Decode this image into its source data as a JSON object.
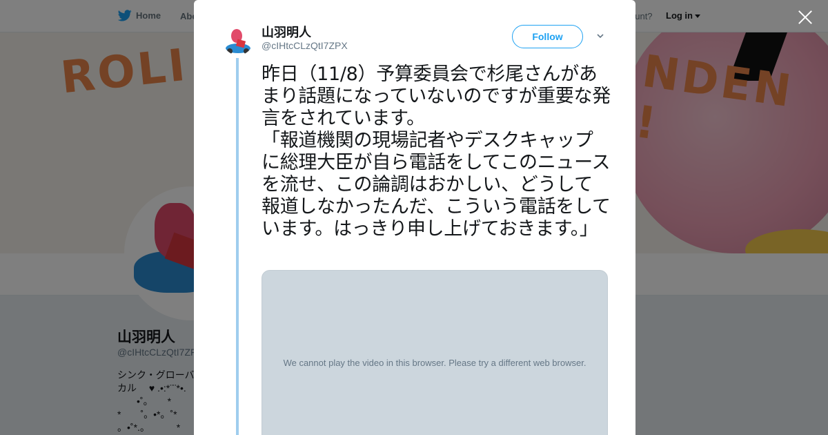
{
  "nav": {
    "home_label": "Home",
    "about_label": "Abo",
    "account_prompt": "ccount?",
    "login_label": "Log in"
  },
  "banner": {
    "text_left": "ROLI",
    "text_right": "NDEN !"
  },
  "profile": {
    "name": "山羽明人",
    "handle": "@cIHtcCLzQtI7ZF",
    "bio": "シンク・グローバ\nカル　 ♥ .•:*¨¨*•.\n　　•˚。　　*\n*　　˚。•*。˚*\n。•˚*.。　　　 *"
  },
  "tweet": {
    "author_name": "山羽明人",
    "author_handle": "@cIHtcCLzQtI7ZPX",
    "follow_label": "Follow",
    "text": "昨日（11/8）予算委員会で杉尾さんがあまり話題になっていないのですが重要な発言をされています。\n「報道機関の現場記者やデスクキャップに総理大臣が自ら電話をしてこのニュースを流せ、この論調はおかしい、どうして報道しなかったんだ、こういう電話をしています。はっきり申し上げておきます。」",
    "video_message": "We cannot play the video in this browser. Please try a different web browser."
  },
  "colors": {
    "accent": "#1da1f2",
    "thread_line": "#9fcdee",
    "video_bg": "#ccd6dd"
  },
  "icons": {
    "logo": "twitter-bird-icon",
    "close": "close-icon",
    "menu": "chevron-down-icon"
  }
}
